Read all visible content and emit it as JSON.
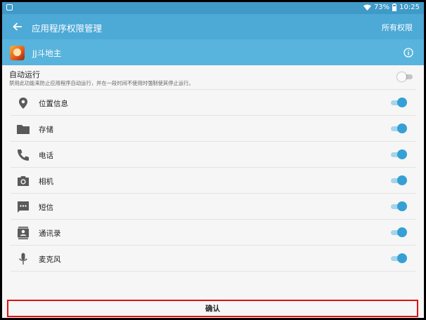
{
  "status_bar": {
    "battery_percent": "73%",
    "time": "10:25",
    "icons": [
      "notification-icon",
      "wifi-icon",
      "battery-icon"
    ]
  },
  "app_bar": {
    "back_icon": "back-arrow-icon",
    "title": "应用程序权限管理",
    "action_label": "所有权限"
  },
  "app_row": {
    "app_name": "JJ斗地主",
    "info_icon": "info-icon"
  },
  "autorun": {
    "title": "自动运行",
    "description": "禁用此功能来防止应用程序自动运行，并在一段时间不使用时强制使其停止运行。",
    "enabled": false
  },
  "permissions": [
    {
      "label": "位置信息",
      "icon": "location-icon",
      "enabled": true
    },
    {
      "label": "存储",
      "icon": "folder-icon",
      "enabled": true
    },
    {
      "label": "电话",
      "icon": "phone-icon",
      "enabled": true
    },
    {
      "label": "相机",
      "icon": "camera-icon",
      "enabled": true
    },
    {
      "label": "短信",
      "icon": "sms-icon",
      "enabled": true
    },
    {
      "label": "通讯录",
      "icon": "contacts-icon",
      "enabled": true
    },
    {
      "label": "麦克风",
      "icon": "microphone-icon",
      "enabled": true
    }
  ],
  "confirm_label": "确认",
  "colors": {
    "app_bar": "#4da9d6",
    "status_bar": "#3f9ac8",
    "toggle_on": "#35a0d5",
    "highlight_border": "#e01010"
  }
}
